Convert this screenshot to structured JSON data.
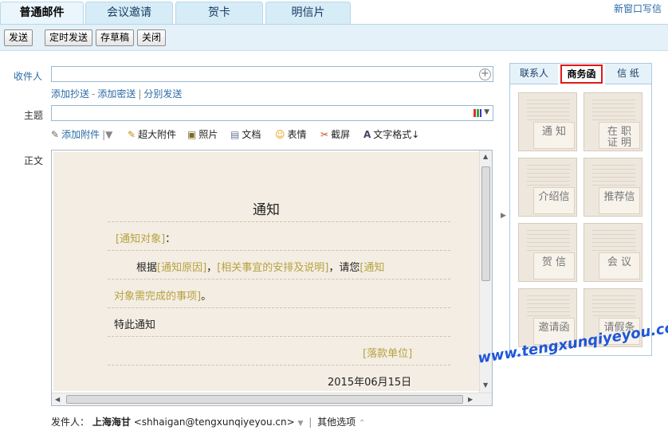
{
  "tabs": [
    "普通邮件",
    "会议邀请",
    "贺卡",
    "明信片"
  ],
  "new_window_link": "新窗口写信",
  "toolbar": {
    "send": "发送",
    "scheduled_send": "定时发送",
    "save_draft": "存草稿",
    "close": "关闭"
  },
  "form": {
    "to_label": "收件人",
    "to_value": "",
    "add_cc": "添加抄送",
    "add_bcc": "添加密送",
    "separate_send": "分别发送",
    "subject_label": "主题",
    "subject_value": "",
    "body_label": "正文"
  },
  "attach_bar": {
    "add_attachment": "添加附件",
    "large_attachment": "超大附件",
    "photo": "照片",
    "document": "文档",
    "emoticon": "表情",
    "screenshot": "截屏",
    "text_format": "文字格式↓"
  },
  "letter": {
    "title": "通知",
    "target_placeholder": "[通知对象]",
    "colon": "：",
    "body_prefix": "根据",
    "reason_placeholder": "[通知原因]",
    "comma": "，",
    "arrangement_placeholder": "[相关事宜的安排及说明]",
    "please": "，请您",
    "todo_placeholder_1": "[通知",
    "todo_placeholder_2": "对象需完成的事项]",
    "period": "。",
    "closing": "特此通知",
    "signature_placeholder": "[落款单位]",
    "date": "2015年06月15日"
  },
  "panel": {
    "tabs": [
      "联系人",
      "商务函",
      "信 纸"
    ],
    "active_tab": "商务函",
    "templates": [
      "通 知",
      "在 职\n证 明",
      "介绍信",
      "推荐信",
      "贺 信",
      "会 议",
      "邀请函",
      "请假条"
    ]
  },
  "watermark": "www.tengxunqiyeyou.com",
  "sender": {
    "label": "发件人：",
    "name": "上海海甘",
    "email": "<shhaigan@tengxunqiyeyou.cn>",
    "other_options": "其他选项"
  },
  "colors": {
    "tab_bg": "#d6ecf7",
    "toolbar_bg": "#e4f1f8",
    "link": "#2a6aa6",
    "placeholder": "#b7a240",
    "active_border": "#e01818"
  }
}
